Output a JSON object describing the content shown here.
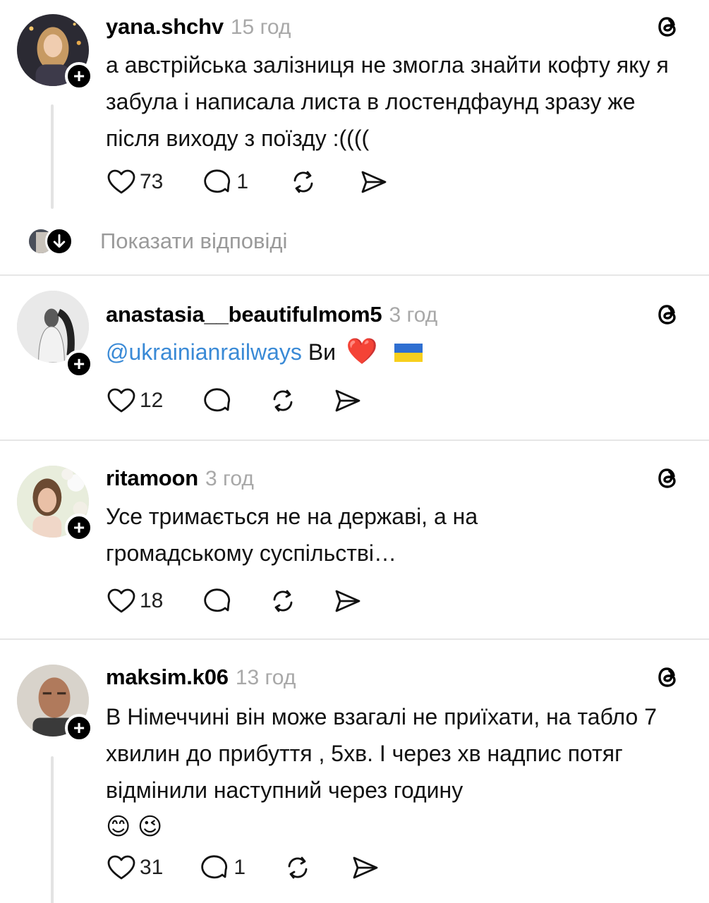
{
  "posts": [
    {
      "username": "yana.shchv",
      "time": "15 год",
      "text": "а австрійська залізниця не змогла знайти кофту яку я забула і написала листа в лостендфаунд зразу же після виходу з поїзду :((((",
      "likes": "73",
      "replies": "1",
      "show_replies_label": "Показати відповіді"
    },
    {
      "username": "anastasia__beautifulmom5",
      "time": "3 год",
      "mention": "@ukrainianrailways",
      "text": "Ви",
      "emoji": "❤️",
      "likes": "12"
    },
    {
      "username": "ritamoon",
      "time": "3 год",
      "text": "Усе тримається не на державі, а на громадському суспільстві…",
      "likes": "18"
    },
    {
      "username": "maksim.k06",
      "time": "13 год",
      "text": "В Німеччині він може взагалі не приїхати, на табло 7 хвилин до прибуття , 5хв. І через хв надпис потяг відмінили наступний через годину",
      "emoji": "😊 😉",
      "likes": "31",
      "replies": "1"
    }
  ],
  "icons": {
    "follow": "plus-icon",
    "threads": "threads-logo-icon",
    "like": "heart-icon",
    "reply": "comment-icon",
    "repost": "repost-icon",
    "share": "send-icon",
    "expand": "arrow-down-icon",
    "flag": "ukraine-flag-icon"
  },
  "colors": {
    "mention": "#3a8ad6",
    "muted": "#a8a8a8",
    "heart": "#e0202e",
    "flag_blue": "#2f6fd1",
    "flag_yellow": "#f7cf1d"
  }
}
